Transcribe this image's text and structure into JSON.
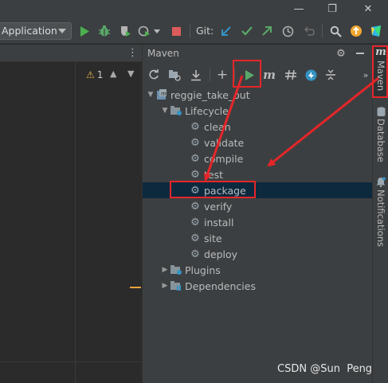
{
  "toolbar": {
    "run_config": "Application",
    "git_label": "Git:",
    "icons": [
      "run-icon",
      "debug-icon",
      "coverage-icon",
      "profile-icon",
      "stop-icon",
      "git-update-icon",
      "git-commit-icon",
      "git-push-icon",
      "history-icon",
      "rollback-icon",
      "search-icon",
      "update-icon",
      "plugin-icon"
    ],
    "colors": {
      "run": "#4caf50",
      "debug": "#59a869",
      "stop": "#db5c5c",
      "git_update": "#3592c4",
      "git_commit": "#59a869",
      "git_push": "#59a869",
      "update": "#f0a732"
    }
  },
  "window": {
    "minimize": "—",
    "restore": "❐",
    "close": "✕"
  },
  "editor": {
    "warning_count": "1"
  },
  "maven": {
    "title": "Maven",
    "project": "reggie_take_out",
    "lifecycle_label": "Lifecycle",
    "lifecycle": [
      {
        "label": "clean"
      },
      {
        "label": "validate"
      },
      {
        "label": "compile"
      },
      {
        "label": "test"
      },
      {
        "label": "package"
      },
      {
        "label": "verify"
      },
      {
        "label": "install"
      },
      {
        "label": "site"
      },
      {
        "label": "deploy"
      }
    ],
    "plugins_label": "Plugins",
    "dependencies_label": "Dependencies",
    "selected": "package",
    "colors": {
      "selection": "#0d293e",
      "run_button": "#59a869",
      "annotation": "#e5262a"
    }
  },
  "side_stripe": {
    "maven_tab": "Maven",
    "database_tab": "Database",
    "notifications_tab": "Notifications"
  },
  "watermark": "CSDN @Sun  Peng"
}
